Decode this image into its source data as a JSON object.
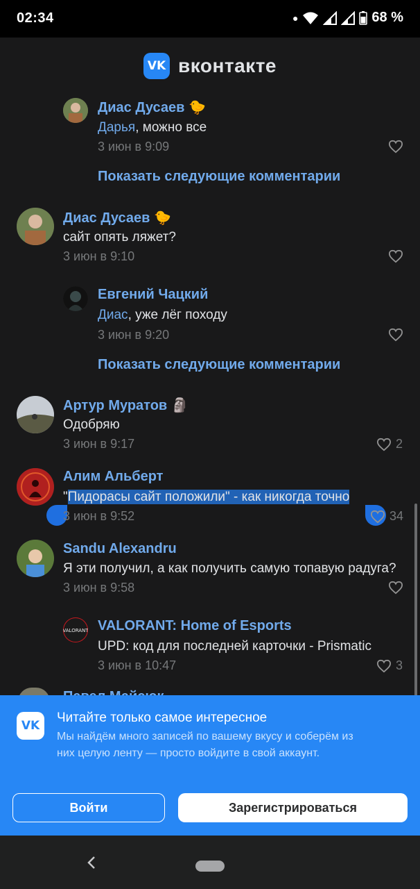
{
  "status_bar": {
    "time": "02:34",
    "battery": "68 %"
  },
  "header": {
    "logo_text": "VK",
    "brand": "вконтакте"
  },
  "comments": [
    {
      "name": "Диас Дусаев",
      "emoji": "🐤",
      "mention": "Дарья",
      "text": ", можно все",
      "date": "3 июн в 9:09",
      "likes": ""
    },
    {
      "name": "Диас Дусаев",
      "emoji": "🐤",
      "mention": "",
      "text": "сайт опять ляжет?",
      "date": "3 июн в 9:10",
      "likes": ""
    },
    {
      "name": "Евгений Чацкий",
      "emoji": "",
      "mention": "Диас",
      "text": ", уже лёг походу",
      "date": "3 июн в 9:20",
      "likes": ""
    },
    {
      "name": "Артур Муратов",
      "emoji": "🗿",
      "mention": "",
      "text": "Одобряю",
      "date": "3 июн в 9:17",
      "likes": "2"
    },
    {
      "name": "Алим Альберт",
      "emoji": "",
      "mention": "",
      "text_prefix": "\"",
      "text": "Пидорасы сайт положили\" - как никогда точно",
      "date": "3 июн в 9:52",
      "likes": "34"
    },
    {
      "name": "Sandu Alexandru",
      "emoji": "",
      "mention": "",
      "text": "Я эти получил, а как получить самую топавую радуга?",
      "date": "3 июн в 9:58",
      "likes": ""
    },
    {
      "name": "VALORANT: Home of Esports",
      "emoji": "",
      "mention": "",
      "text": "UPD: код для последней карточки - Prismatic",
      "date": "3 июн в 10:47",
      "likes": "3"
    }
  ],
  "show_more": [
    "Показать следующие комментарии",
    "Показать следующие комментарии"
  ],
  "peek_name": "Павел Майсюк",
  "promo": {
    "title": "Читайте только самое интересное",
    "text": "Мы найдём много записей по вашему вкусу и соберём из них целую ленту — просто войдите в свой аккаунт.",
    "login": "Войти",
    "register": "Зарегистрироваться"
  },
  "colors": {
    "background": "#19191a",
    "accent": "#2787f5",
    "link": "#71aaeb",
    "muted": "#76787a"
  }
}
